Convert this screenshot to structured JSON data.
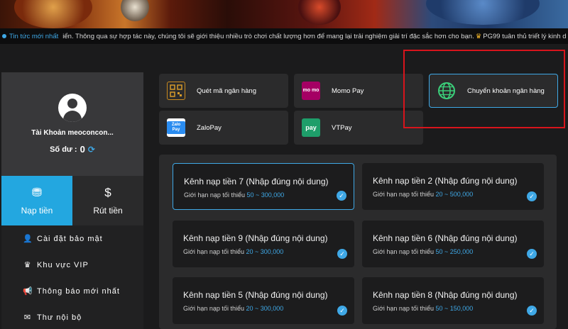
{
  "ticker": {
    "label": "Tin tức mới nhất",
    "message": "iển. Thông qua sự hợp tác này, chúng tôi sẽ giới thiệu nhiều trò chơi chất lượng hơn để mang lại trải nghiệm giải trí đặc sắc hơn cho bạn.",
    "message2": "PG99 tuân thủ triết lý kinh d"
  },
  "profile": {
    "account": "Tài Khoản meoconcon...",
    "balance_label": "Số dư :",
    "balance_value": "0"
  },
  "tabs": [
    {
      "label": "Nạp tiền",
      "icon": "coin-hand-icon"
    },
    {
      "label": "Rút tiền",
      "icon": "money-hand-icon"
    }
  ],
  "menu": [
    {
      "label": "Cài đặt bảo mật",
      "icon": "user-lock-icon"
    },
    {
      "label": "Khu vực VIP",
      "icon": "crown-icon"
    },
    {
      "label": "Thông báo mới nhất",
      "icon": "megaphone-icon"
    },
    {
      "label": "Thư nội bộ",
      "icon": "mail-icon"
    }
  ],
  "methods": [
    {
      "label": "Quét mã ngân hàng",
      "logo": "QR"
    },
    {
      "label": "Momo Pay",
      "logo": "mo mo"
    },
    {
      "label": "Chuyển khoản ngân hàng",
      "logo": "globe"
    },
    {
      "label": "ZaloPay",
      "logo": "Zalo Pay"
    },
    {
      "label": "VTPay",
      "logo": "pay"
    }
  ],
  "channels": [
    {
      "title": "Kênh nạp tiền 7 (Nhập đúng nội dung)",
      "limit_label": "Giới hạn nạp tối thiểu",
      "range": "50 ~ 300,000"
    },
    {
      "title": "Kênh nạp tiền 2 (Nhập đúng nội dung)",
      "limit_label": "Giới hạn nạp tối thiểu",
      "range": "20 ~ 500,000"
    },
    {
      "title": "Kênh nạp tiền 9 (Nhập đúng nội dung)",
      "limit_label": "Giới hạn nạp tối thiểu",
      "range": "20 ~ 300,000"
    },
    {
      "title": "Kênh nạp tiền 6 (Nhập đúng nội dung)",
      "limit_label": "Giới hạn nạp tối thiểu",
      "range": "50 ~ 250,000"
    },
    {
      "title": "Kênh nạp tiền 5 (Nhập đúng nội dung)",
      "limit_label": "Giới hạn nạp tối thiểu",
      "range": "20 ~ 300,000"
    },
    {
      "title": "Kênh nạp tiền 8 (Nhập đúng nội dung)",
      "limit_label": "Giới hạn nạp tối thiểu",
      "range": "50 ~ 150,000"
    }
  ],
  "colors": {
    "accent": "#23a7e0",
    "highlight": "#d8141c"
  }
}
